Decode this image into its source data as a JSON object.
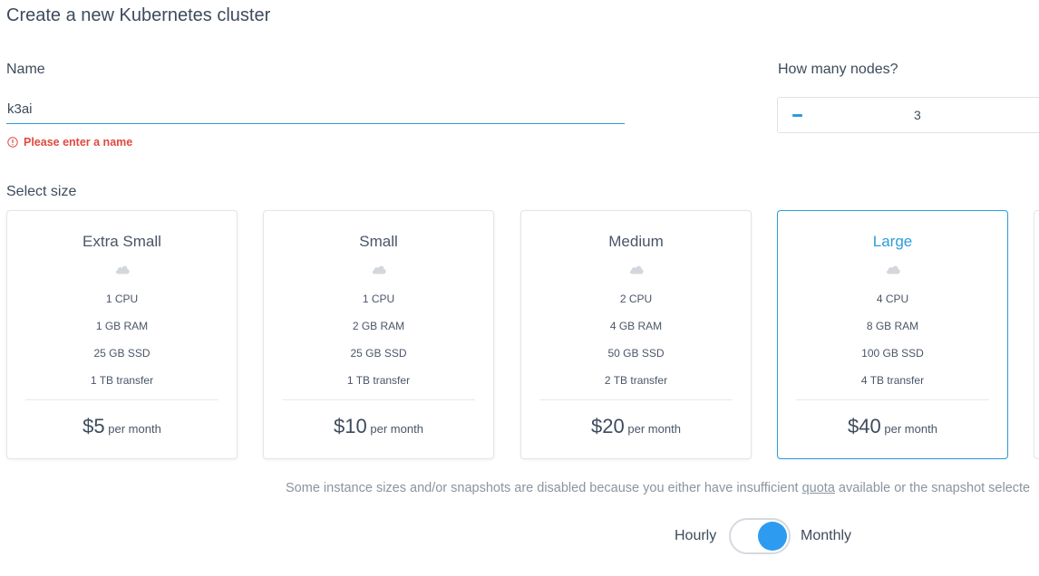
{
  "page": {
    "title": "Create a new Kubernetes cluster"
  },
  "name_field": {
    "label": "Name",
    "value": "k3ai",
    "error": "Please enter a name"
  },
  "nodes": {
    "label": "How many nodes?",
    "value": "3"
  },
  "size": {
    "label": "Select size",
    "price_suffix": "per month",
    "plans": [
      {
        "name": "Extra Small",
        "cpu": "1 CPU",
        "ram": "1 GB RAM",
        "ssd": "25 GB SSD",
        "transfer": "1 TB transfer",
        "price": "$5",
        "selected": false
      },
      {
        "name": "Small",
        "cpu": "1 CPU",
        "ram": "2 GB RAM",
        "ssd": "25 GB SSD",
        "transfer": "1 TB transfer",
        "price": "$10",
        "selected": false
      },
      {
        "name": "Medium",
        "cpu": "2 CPU",
        "ram": "4 GB RAM",
        "ssd": "50 GB SSD",
        "transfer": "2 TB transfer",
        "price": "$20",
        "selected": false
      },
      {
        "name": "Large",
        "cpu": "4 CPU",
        "ram": "8 GB RAM",
        "ssd": "100 GB SSD",
        "transfer": "4 TB transfer",
        "price": "$40",
        "selected": true
      }
    ]
  },
  "notice": {
    "before": "Some instance sizes and/or snapshots are disabled because you either have insufficient ",
    "link": "quota",
    "after": " available or the snapshot selecte"
  },
  "billing": {
    "hourly_label": "Hourly",
    "monthly_label": "Monthly",
    "selected": "Monthly"
  },
  "colors": {
    "accent": "#2d9cdb",
    "error": "#e04a3f"
  },
  "icons": {
    "error": "alert-circle-icon",
    "cloud": "cloud-icon",
    "minus": "minus-icon"
  }
}
